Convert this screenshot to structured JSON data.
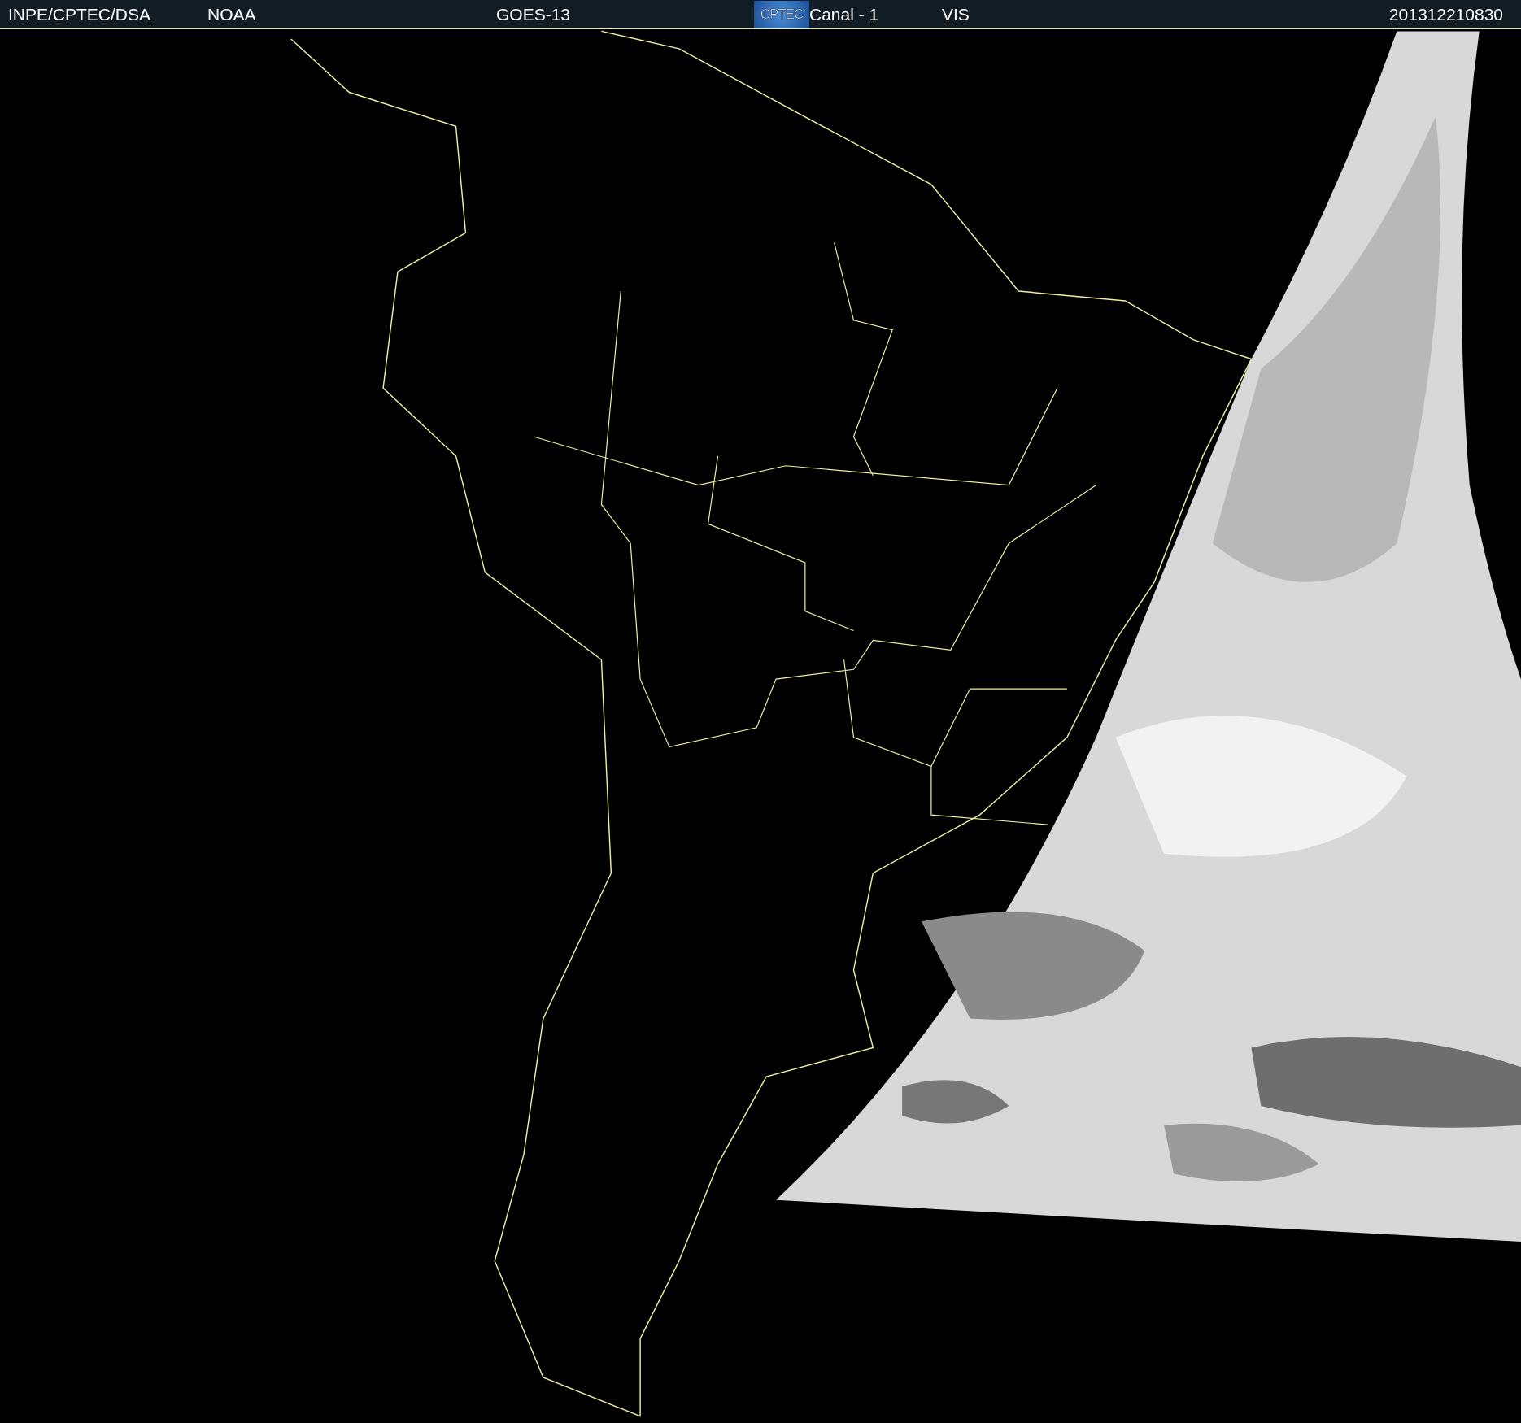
{
  "header": {
    "source": "INPE/CPTEC/DSA",
    "agency": "NOAA",
    "satellite": "GOES-13",
    "logo": "CPTEC",
    "channel": "Canal - 1",
    "band": "VIS",
    "timestamp": "201312210830"
  }
}
